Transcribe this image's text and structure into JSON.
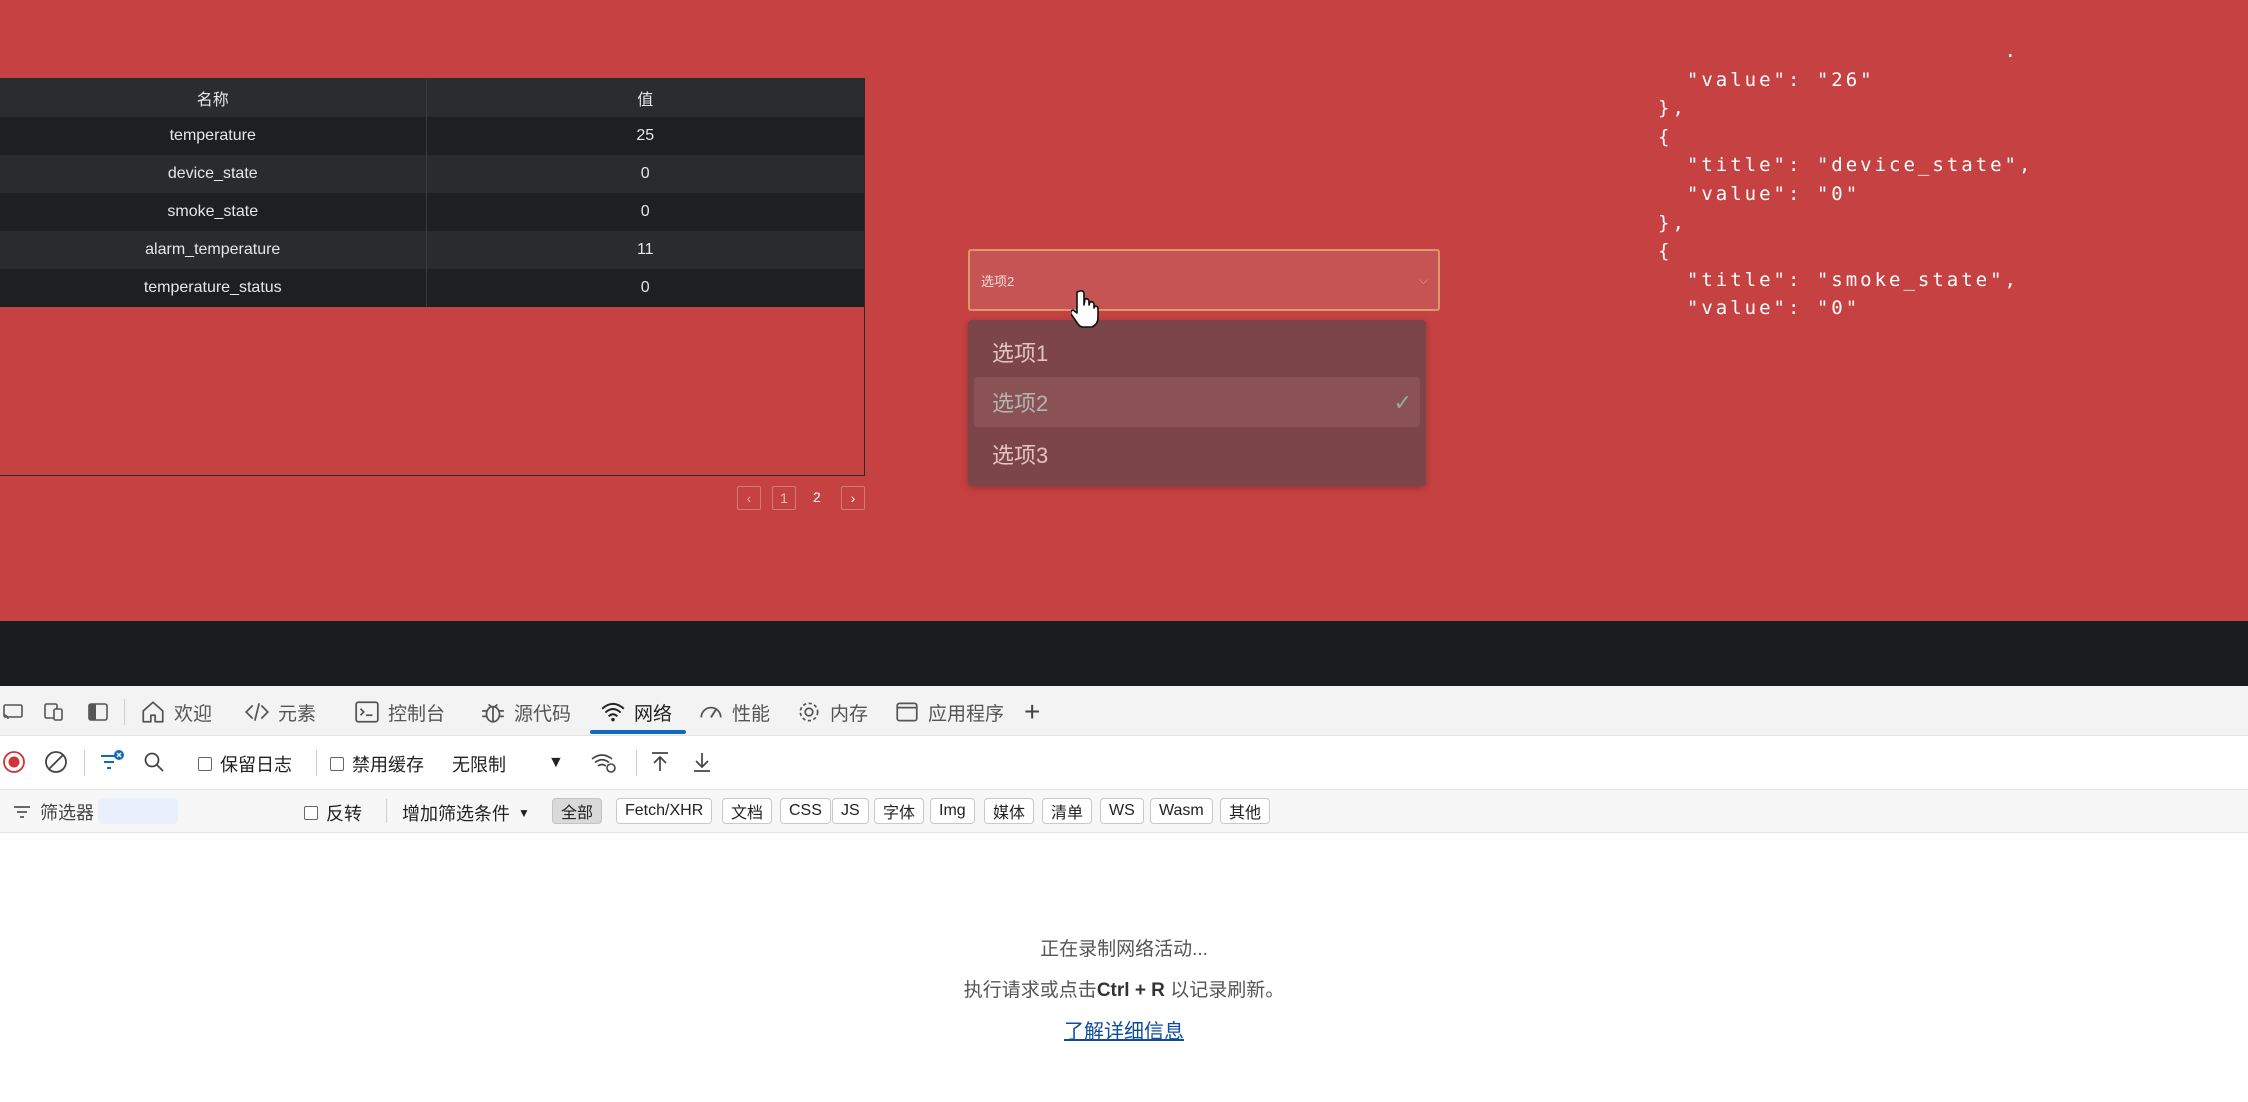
{
  "table": {
    "headers": [
      "名称",
      "值"
    ],
    "rows": [
      {
        "name": "temperature",
        "value": "25"
      },
      {
        "name": "device_state",
        "value": "0"
      },
      {
        "name": "smoke_state",
        "value": "0"
      },
      {
        "name": "alarm_temperature",
        "value": "11"
      },
      {
        "name": "temperature_status",
        "value": "0"
      }
    ]
  },
  "pagination": {
    "prev": "‹",
    "pages": [
      "1",
      "2"
    ],
    "next": "›",
    "current": "1"
  },
  "select": {
    "value": "选项2",
    "options": [
      {
        "label": "选项1"
      },
      {
        "label": "选项2",
        "selected": true
      },
      {
        "label": "选项3"
      }
    ]
  },
  "json_text": {
    "lines": [
      "                        .",
      "  \"value\": \"26\"",
      "},",
      "{",
      "  \"title\": \"device_state\",",
      "  \"value\": \"0\"",
      "},",
      "{",
      "  \"title\": \"smoke_state\",",
      "  \"value\": \"0\""
    ]
  },
  "devtools": {
    "tabs": [
      {
        "label": "欢迎",
        "icon": "home-icon"
      },
      {
        "label": "元素",
        "icon": "code-icon"
      },
      {
        "label": "控制台",
        "icon": "console-icon"
      },
      {
        "label": "源代码",
        "icon": "bug-icon"
      },
      {
        "label": "网络",
        "icon": "wifi-icon",
        "active": true
      },
      {
        "label": "性能",
        "icon": "gauge-icon"
      },
      {
        "label": "内存",
        "icon": "gear-icon"
      },
      {
        "label": "应用程序",
        "icon": "window-icon"
      }
    ],
    "add_tab": "+",
    "toolbar": {
      "preserve_log": "保留日志",
      "disable_cache": "禁用缓存",
      "throttling": "无限制"
    },
    "filter": {
      "placeholder": "筛选器",
      "invert": "反转",
      "more_filters": "增加筛选条件",
      "chips": [
        "全部",
        "Fetch/XHR",
        "文档",
        "CSS",
        "JS",
        "字体",
        "Img",
        "媒体",
        "清单",
        "WS",
        "Wasm",
        "其他"
      ],
      "active_chip": "全部"
    },
    "empty": {
      "recording": "正在录制网络活动...",
      "hint_prefix": "执行请求或点击",
      "hint_shortcut": "Ctrl + R",
      "hint_suffix": " 以记录刷新。",
      "learn_more": "了解详细信息"
    }
  },
  "colors": {
    "page_bg": "#c64242",
    "accent_blue": "#0f6cbd",
    "record_red": "#d13438"
  }
}
